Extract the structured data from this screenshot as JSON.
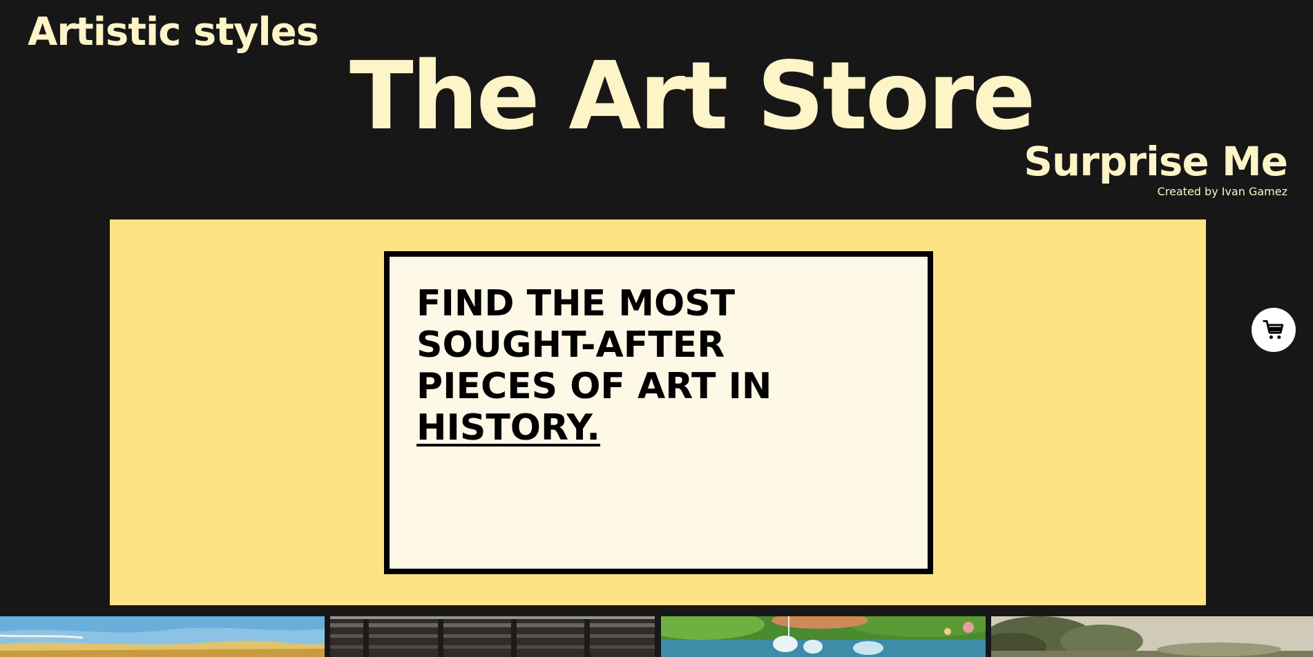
{
  "header": {
    "styles_link": "Artistic styles",
    "title": "The Art Store",
    "surprise_link": "Surprise Me",
    "credit": "Created by Ivan Gamez"
  },
  "hero": {
    "line1": "FIND THE MOST",
    "line2": "SOUGHT-AFTER",
    "line3": "PIECES OF ART IN",
    "line4": "HISTORY."
  },
  "cart": {
    "icon": "shopping-cart-icon"
  },
  "gallery": {
    "items": [
      {
        "name": "painting-1"
      },
      {
        "name": "painting-2"
      },
      {
        "name": "painting-3"
      },
      {
        "name": "painting-4"
      }
    ]
  },
  "colors": {
    "background": "#171717",
    "title_cream": "#FDF4C8",
    "hero_yellow": "#FDE383",
    "card_cream": "#FEF9E6",
    "ink": "#000000"
  }
}
